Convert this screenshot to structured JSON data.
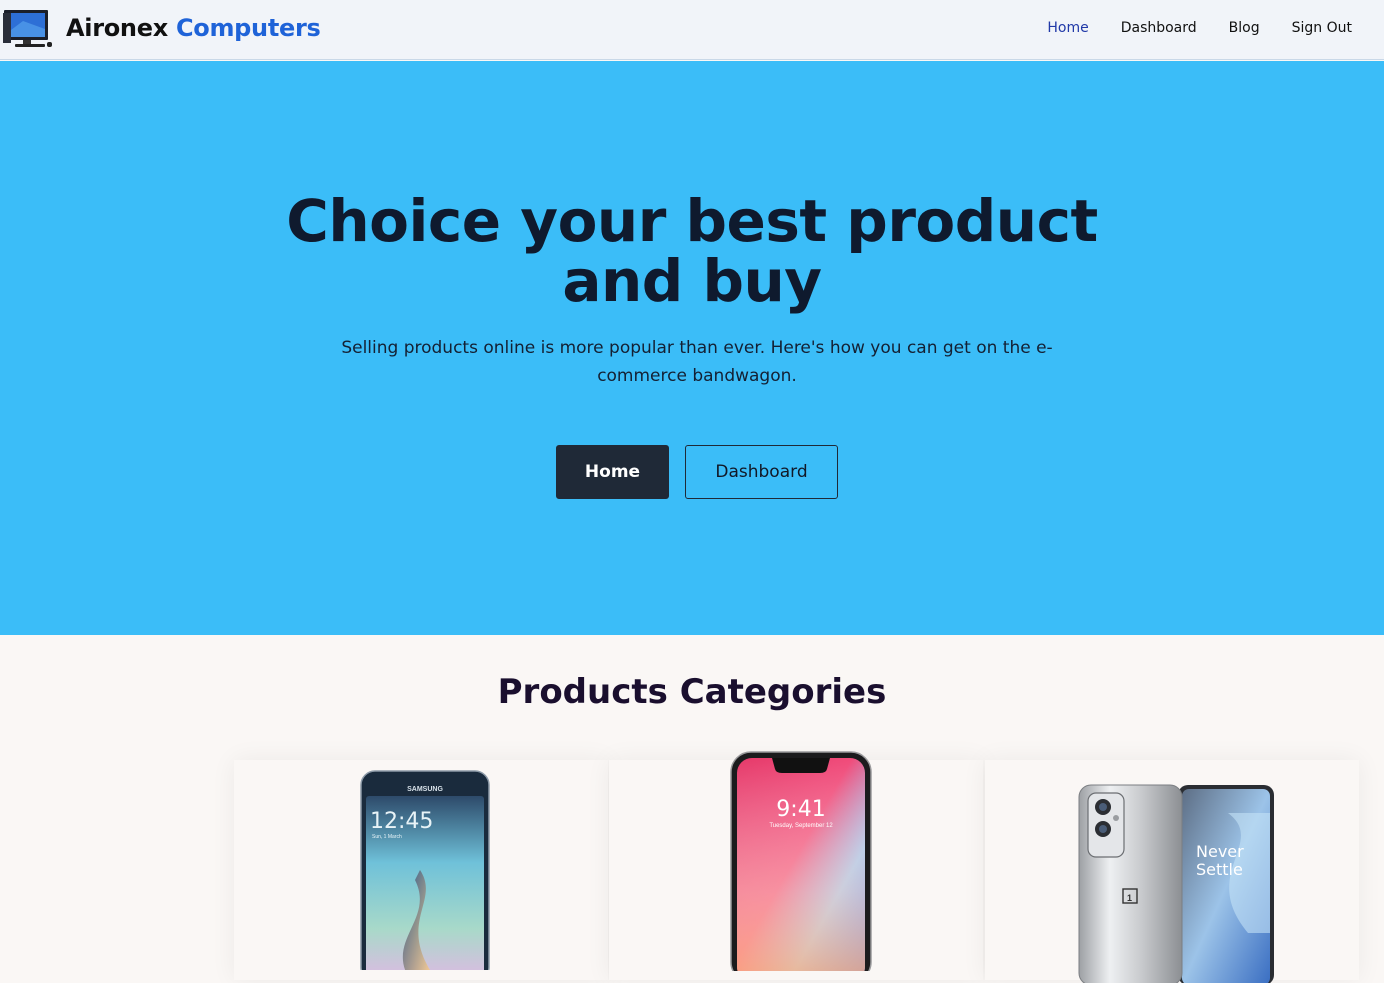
{
  "brand": {
    "name_part1": "Aironex",
    "name_part2": "Computers"
  },
  "nav": {
    "items": [
      "Home",
      "Dashboard",
      "Blog",
      "Sign Out"
    ]
  },
  "hero": {
    "title_line1": "Choice your best product",
    "title_line2": "and buy",
    "subtitle": "Selling products online is more popular than ever. Here's how you can get on the e-commerce bandwagon.",
    "primary_button": "Home",
    "secondary_button": "Dashboard"
  },
  "categories": {
    "title": "Products Categories",
    "items": [
      {
        "brand_text": "SAMSUNG",
        "time": "12:45",
        "date": "Sun, 1 March"
      },
      {
        "time": "9:41",
        "date": "Tuesday, September 12"
      },
      {
        "text_line1": "Never",
        "text_line2": "Settle"
      }
    ]
  },
  "colors": {
    "hero_bg": "#3bbdf8",
    "brand_accent": "#1f63d8",
    "button_dark": "#1f2937",
    "nav_active": "#2139a8"
  }
}
